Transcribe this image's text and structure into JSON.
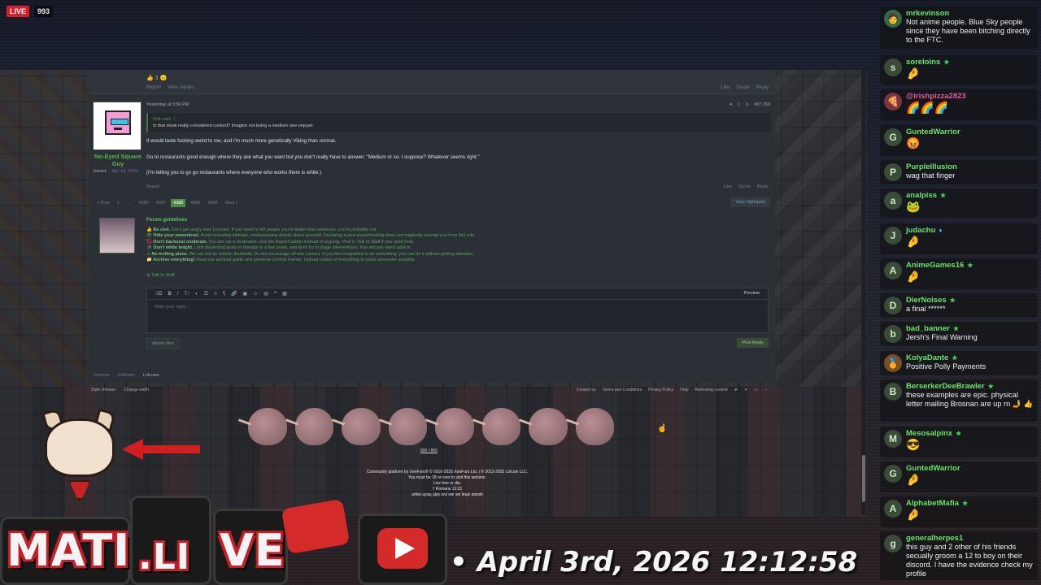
{
  "stream": {
    "live_label": "LIVE",
    "viewer_count": "993",
    "timestamp": "• April 3rd, 2026 12:12:58",
    "logo_text_1": "MATI",
    "logo_text_2": ".LI",
    "logo_text_3": "VE"
  },
  "forum": {
    "top_reactions": "👍 3 😐",
    "top_report": "Report",
    "top_view_replies": "View replies",
    "top_like": "Like",
    "top_quote": "Quote",
    "top_reply": "Reply",
    "post": {
      "username": "No-Eyed Square Guy",
      "joined_label": "Joined:",
      "joined_date": "Apr 19, 2025",
      "time": "Yesterday at 3:56 PM",
      "post_number": "#87,760",
      "quote_header": "Null said: ⓘ",
      "quote_text": "Is that steak really considered cooked? Imagine not being a medium rare enjoyer.",
      "line1": "It would taste fucking weird to me, and I'm much more genetically Viking than normal.",
      "line2": "Go to restaurants good enough where they ask what you want but you don't really have to answer. \"Medium or so, I suppose? Whatever seems right.\"",
      "line3": "(I'm telling you to go go restaurants where everyone who works there is white.)",
      "report": "Report",
      "like": "Like",
      "quote": "Quote",
      "reply": "Reply"
    },
    "pager": {
      "prev": "« Prev",
      "pages": [
        "1",
        "…",
        "4386",
        "4387",
        "4388",
        "4389",
        "4390"
      ],
      "current": "4388",
      "next": "Next »",
      "filter": "View highlights"
    },
    "guidelines": {
      "title": "Forum guidelines",
      "items": [
        {
          "head": "Be civil.",
          "body": "Don't get angry over Lolcows. If you need to tell people you're better than someone, you're probably not."
        },
        {
          "head": "Hide your powerlevel.",
          "body": "Avoid revealing intimate, embarrassing details about yourself. Declaring a post powerleveling does not magically exempt you from this rule."
        },
        {
          "head": "Don't backseat moderate.",
          "body": "You are not a moderator. Use the Report button instead of arguing. Post in Talk to Staff if you need help."
        },
        {
          "head": "Don't white knight.",
          "body": "Limit dissenting posts in threads to a few posts, and don't try to stage interventions; true lolcows reject advice."
        },
        {
          "head": "No trolling plans.",
          "body": "We are not an autistic Illuminati. Do not encourage off-site contact. If you feel compelled to do something, you can do it without getting attention."
        },
        {
          "head": "Archive everything!",
          "body": "Read our archival guide and preserve content forever. Upload copies of everything to posts whenever possible."
        }
      ],
      "talk_to_staff": "Talk to Staff"
    },
    "editor": {
      "placeholder": "Write your reply...",
      "preview": "Preview",
      "attach": "Attach files",
      "post_reply": "Post Reply"
    },
    "breadcrumbs": [
      "Forums",
      "Criticism",
      "Lolcows"
    ],
    "footer": {
      "style_chooser": "Style chooser",
      "change_width": "Change width",
      "links": [
        "Contact us",
        "Terms and Conditions",
        "Privacy Policy",
        "Help",
        "Removing content"
      ],
      "kiwi_count": "800 / 800",
      "copyright_lines": [
        "Community platform by XenForo® © 2010-2025 XenForo Ltd. | © 2013-2025 Lolcow LLC.",
        "You must be 18 or over to visit this website.",
        "Live free or die.",
        "† Romans 12:21",
        "ɹǝʇɐʍ ɥsǝɹɟ ɥʇᴉʍ ǝʌᴉl ǝɹɐ ǝʍ ʇɐɥʍ ǝpᴉsdn"
      ]
    }
  },
  "chat": [
    {
      "name": "mrkevinson",
      "avatar": "🧑",
      "text": "Not anime people. Blue Sky people since they have been bitching directly to the FTC.",
      "color": "green"
    },
    {
      "name": "soreloins",
      "avatar": "s",
      "badge": "★",
      "emote": "🤌"
    },
    {
      "name": "@irishpizza2823",
      "avatar": "🍕",
      "emote": "🌈🌈🌈",
      "color": "pink"
    },
    {
      "name": "GuntedWarrior",
      "avatar": "G",
      "emote": "😡"
    },
    {
      "name": "PurpleIllusion",
      "avatar": "P",
      "text": "wag that finger"
    },
    {
      "name": "analpiss",
      "avatar": "a",
      "badge": "★",
      "emote": "🐸"
    },
    {
      "name": "judachu",
      "avatar": "J",
      "badge": "♦",
      "badge_color": "blue",
      "emote": "🤌"
    },
    {
      "name": "AnimeGames16",
      "avatar": "A",
      "badge": "★",
      "emote": "🤌"
    },
    {
      "name": "DierNoises",
      "avatar": "D",
      "badge": "★",
      "text": "a final ******"
    },
    {
      "name": "bad_banner",
      "avatar": "b",
      "badge": "★",
      "text": "Jersh's Final Warning"
    },
    {
      "name": "KolyaDante",
      "avatar": "🏅",
      "badge": "★",
      "text": "Positive Polly Payments"
    },
    {
      "name": "BerserkerDeeBrawler",
      "avatar": "B",
      "badge": "★",
      "text": "these examples are epic. physical letter mailing Brosnan are up rn 🤳 👍"
    },
    {
      "name": "Mesosalpinx",
      "avatar": "M",
      "badge": "★",
      "emote": "😎"
    },
    {
      "name": "GuntedWarrior",
      "avatar": "G",
      "emote": "🤌"
    },
    {
      "name": "AlphabetMafia",
      "avatar": "A",
      "badge": "★",
      "emote": "🤌"
    },
    {
      "name": "generalherpes1",
      "avatar": "g",
      "text": "this guy and 2 other of his friends secually groom a 12 to boy on their discord. I have the evidence check my profile"
    }
  ]
}
